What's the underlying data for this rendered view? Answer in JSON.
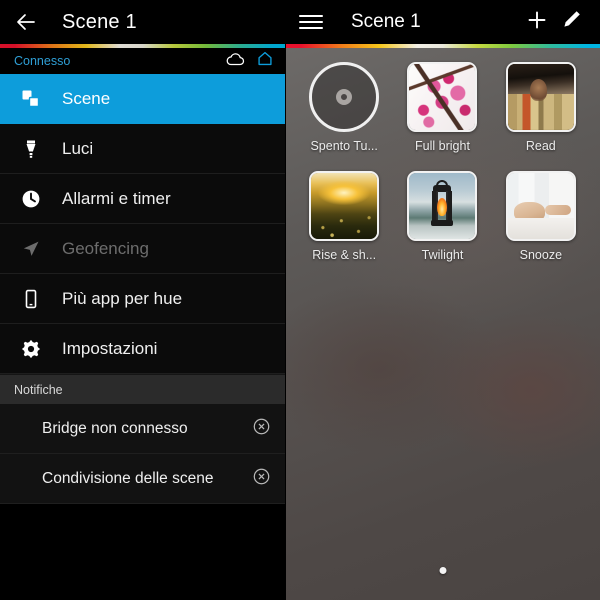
{
  "left_panel": {
    "topbar": {
      "back_icon": "arrow-left-icon",
      "title": "Scene 1"
    },
    "status_row": {
      "label": "Connesso",
      "label_color": "#2f9fd6",
      "cloud_icon": "cloud-icon",
      "home_icon": "home-icon",
      "home_icon_color": "#0d9ddb"
    },
    "menu_items": [
      {
        "label": "Scene",
        "icon": "scenes-icon",
        "active": true,
        "disabled": false
      },
      {
        "label": "Luci",
        "icon": "bulb-icon",
        "active": false,
        "disabled": false
      },
      {
        "label": "Allarmi e timer",
        "icon": "clock-icon",
        "active": false,
        "disabled": false
      },
      {
        "label": "Geofencing",
        "icon": "location-icon",
        "active": false,
        "disabled": true
      },
      {
        "label": "Più app per hue",
        "icon": "smartphone-icon",
        "active": false,
        "disabled": false
      },
      {
        "label": "Impostazioni",
        "icon": "gear-icon",
        "active": false,
        "disabled": false
      }
    ],
    "notifications": {
      "header": "Notifiche",
      "items": [
        {
          "label": "Bridge non connesso",
          "dismiss_icon": "close-circle-icon"
        },
        {
          "label": "Condivisione delle scene",
          "dismiss_icon": "close-circle-icon"
        }
      ]
    },
    "accent_color": "#0d9ddb"
  },
  "right_panel": {
    "topbar": {
      "menu_icon": "hamburger-icon",
      "title": "Scene 1",
      "add_icon": "plus-icon",
      "edit_icon": "pencil-icon"
    },
    "scenes": [
      {
        "label": "Spento Tu...",
        "art": "off-circle",
        "selected": false
      },
      {
        "label": "Full bright",
        "art": "blossom",
        "selected": false
      },
      {
        "label": "Read",
        "art": "read",
        "selected": false
      },
      {
        "label": "Rise & sh...",
        "art": "sunrise",
        "selected": false
      },
      {
        "label": "Twilight",
        "art": "twilight",
        "selected": false
      },
      {
        "label": "Snooze",
        "art": "snooze",
        "selected": false
      }
    ],
    "pagination": {
      "pages": 1,
      "current": 1
    }
  }
}
